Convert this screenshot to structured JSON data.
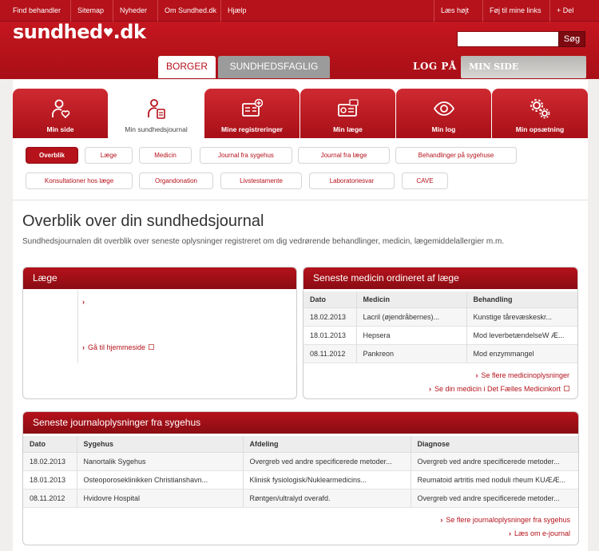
{
  "topbar": {
    "left": [
      "Find behandler",
      "Sitemap",
      "Nyheder",
      "Om Sundhed.dk",
      "Hjælp"
    ],
    "right": [
      "Læs højt",
      "Føj til mine links",
      "+ Del"
    ]
  },
  "header": {
    "logo": "sundhed",
    "logo_suffix": ".dk",
    "search_placeholder": "",
    "search_button": "Søg",
    "tab_borger": "BORGER",
    "tab_sundhedsfaglig": "SUNDHEDSFAGLIG",
    "login": "LOG PÅ",
    "min_side": "MIN SIDE"
  },
  "icon_tabs": [
    {
      "label": "Min side",
      "icon": "person-heart-icon"
    },
    {
      "label": "Min sundhedsjournal",
      "icon": "person-document-icon"
    },
    {
      "label": "Mine registreringer",
      "icon": "id-card-plus-icon"
    },
    {
      "label": "Min læge",
      "icon": "card-clock-icon"
    },
    {
      "label": "Min log",
      "icon": "eye-icon"
    },
    {
      "label": "Min opsætning",
      "icon": "gears-icon"
    }
  ],
  "sub_nav": [
    "Overblik",
    "Læge",
    "Medicin",
    "Journal fra sygehus",
    "Journal fra læge",
    "Behandlinger på sygehuse",
    "Konsultationer hos læge",
    "Organdonation",
    "Livstestamente",
    "Laboratoriesvar",
    "CAVE"
  ],
  "page": {
    "title": "Overblik over din sundhedsjournal",
    "subtitle": "Sundhedsjournalen dit overblik over seneste oplysninger registreret om dig vedrørende behandlinger, medicin, lægemiddelallergier m.m."
  },
  "laege_panel": {
    "title": "Læge",
    "home_link": "Gå til hjemmeside"
  },
  "medicin_panel": {
    "title": "Seneste medicin ordineret af læge",
    "columns": [
      "Dato",
      "Medicin",
      "Behandling"
    ],
    "rows": [
      [
        "18.02.2013",
        "Lacril (øjendråbernes)...",
        "Kunstige tårevæskeskr..."
      ],
      [
        "18.01.2013",
        "Hepsera",
        "Mod leverbetændelseW Æ..."
      ],
      [
        "08.11.2012",
        "Pankreon",
        "Mod enzymmangel"
      ]
    ],
    "links": [
      "Se flere medicinoplysninger",
      "Se din medicin i Det Fælles Medicinkort"
    ]
  },
  "journal_panel": {
    "title": "Seneste journaloplysninger fra sygehus",
    "columns": [
      "Dato",
      "Sygehus",
      "Afdeling",
      "Diagnose"
    ],
    "rows": [
      [
        "18.02.2013",
        "Nanortalik Sygehus",
        "Overgreb ved andre specificerede metoder...",
        "Overgreb ved andre specificerede metoder..."
      ],
      [
        "18.01.2013",
        "Osteoporoseklinikken Christianshavn...",
        "Klinisk fysiologisk/Nuklearmedicins...",
        "Reumatoid artritis med noduli rheum KUÆÆ..."
      ],
      [
        "08.11.2012",
        "Hvidovre Hospital",
        "Røntgen/ultralyd overafd.",
        "Overgreb ved andre specificerede metoder..."
      ]
    ],
    "links": [
      "Se flere journaloplysninger fra sygehus",
      "Læs om e-journal"
    ]
  },
  "colors": {
    "brand": "#b5121b",
    "dark": "#8a0c13"
  }
}
